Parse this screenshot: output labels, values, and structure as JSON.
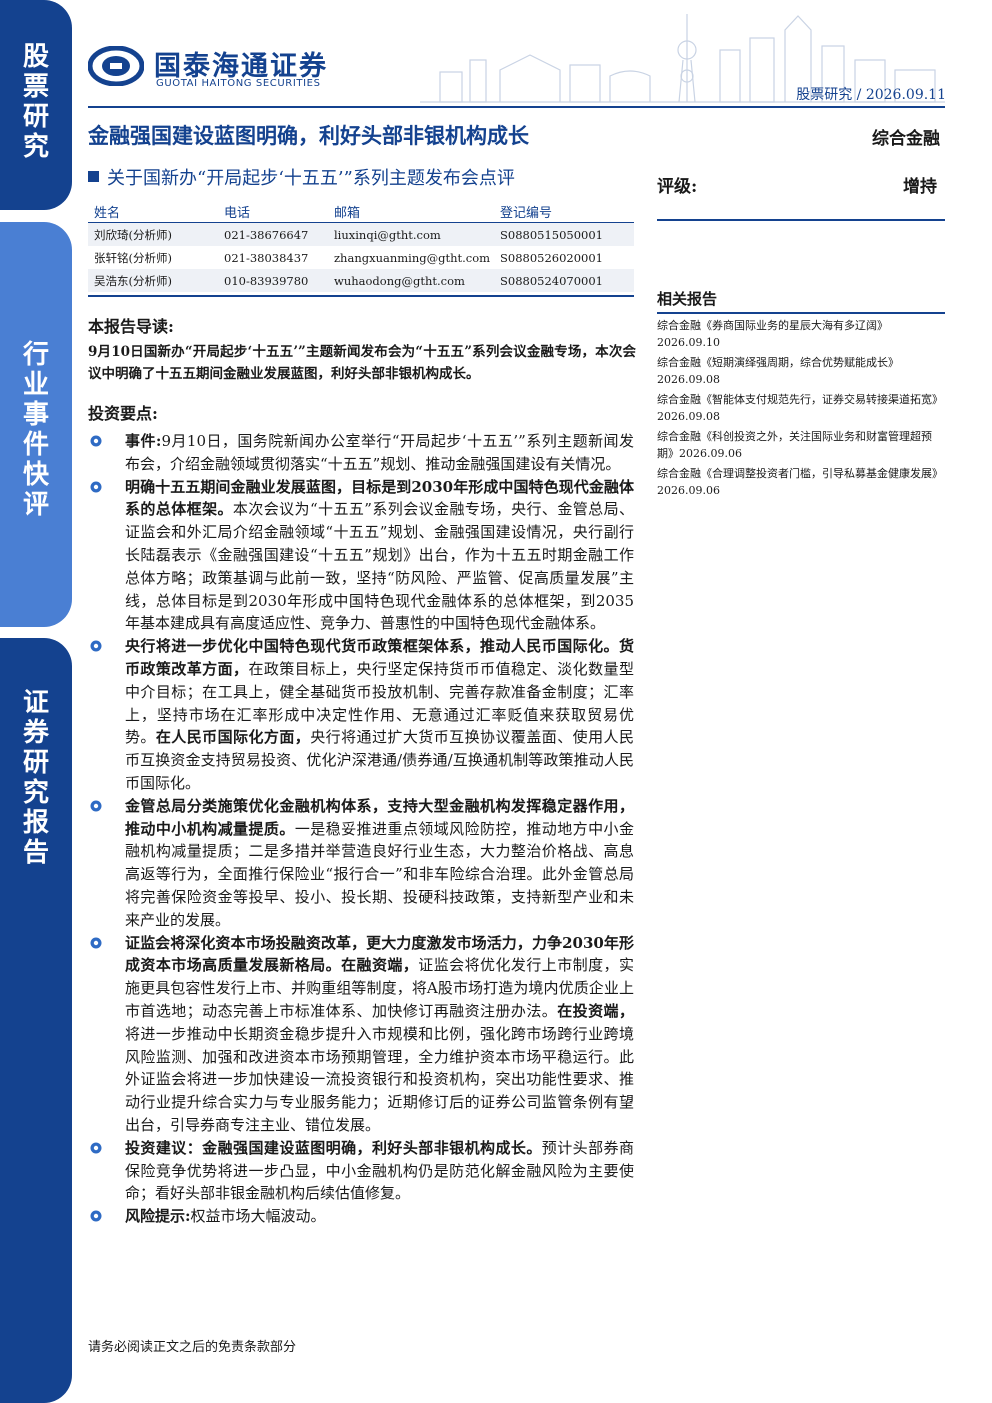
{
  "sidebar": {
    "blocks": [
      {
        "text": "股票研究"
      },
      {
        "text": "行业事件快评"
      },
      {
        "text": "证券研究报告"
      }
    ]
  },
  "logo": {
    "cn": "国泰海通证券",
    "en": "GUOTAI HAITONG SECURITIES"
  },
  "header": {
    "crumb": "股票研究  /  2026.09.11"
  },
  "title": "金融强国建设蓝图明确，利好头部非银机构成长",
  "industry": "综合金融",
  "subtitle": "关于国新办“开局起步‘十五五’”系列主题发布会点评",
  "rating": {
    "label": "评级:",
    "value": "增持"
  },
  "analysts": {
    "headers": [
      "姓名",
      "电话",
      "邮箱",
      "登记编号"
    ],
    "rows": [
      [
        "刘欣琦(分析师)",
        "021-38676647",
        "liuxinqi@gtht.com",
        "S0880515050001"
      ],
      [
        "张轩铭(分析师)",
        "021-38038437",
        "zhangxuanming@gtht.com",
        "S0880526020001"
      ],
      [
        "吴浩东(分析师)",
        "010-83939780",
        "wuhaodong@gtht.com",
        "S0880524070001"
      ]
    ]
  },
  "related": {
    "title": "相关报告",
    "items": [
      "综合金融《券商国际业务的星辰大海有多辽阔》2026.09.10",
      "综合金融《短期演绎强周期，综合优势赋能成长》2026.09.08",
      "综合金融《智能体支付规范先行，证券交易转接渠道拓宽》2026.09.08",
      "综合金融《科创投资之外，关注国际业务和财富管理超预期》2026.09.06",
      "综合金融《合理调整投资者门槛，引导私募基金健康发展》2026.09.06"
    ]
  },
  "guide": {
    "heading": "本报告导读:",
    "text": "9月10日国新办“开局起步‘十五五’”主题新闻发布会为“十五五”系列会议金融专场，本次会议中明确了十五五期间金融业发展蓝图，利好头部非银机构成长。"
  },
  "points_heading": "投资要点:",
  "points": [
    {
      "bold": "事件:",
      "text": "9月10日，国务院新闻办公室举行“开局起步‘十五五’”系列主题新闻发布会，介绍金融领域贯彻落实“十五五”规划、推动金融强国建设有关情况。"
    },
    {
      "bold": "明确十五五期间金融业发展蓝图，目标是到2030年形成中国特色现代金融体系的总体框架。",
      "text": "本次会议为“十五五”系列会议金融专场，央行、金管总局、证监会和外汇局介绍金融领域“十五五”规划、金融强国建设情况，央行副行长陆磊表示《金融强国建设“十五五”规划》出台，作为十五五时期金融工作总体方略；政策基调与此前一致，坚持“防风险、严监管、促高质量发展”主线，总体目标是到2030年形成中国特色现代金融体系的总体框架，到2035年基本建成具有高度适应性、竞争力、普惠性的中国特色现代金融体系。"
    },
    {
      "bold": "央行将进一步优化中国特色现代货币政策框架体系，推动人民币国际化。货币政策改革方面，",
      "text": "在政策目标上，央行坚定保持货币币值稳定、淡化数量型中介目标；在工具上，健全基础货币投放机制、完善存款准备金制度；汇率上，坚持市场在汇率形成中决定性作用、无意通过汇率贬值来获取贸易优势。",
      "bold2": "在人民币国际化方面，",
      "text2": "央行将通过扩大货币互换协议覆盖面、使用人民币互换资金支持贸易投资、优化沪深港通/债券通/互换通机制等政策推动人民币国际化。"
    },
    {
      "bold": "金管总局分类施策优化金融机构体系，支持大型金融机构发挥稳定器作用，推动中小机构减量提质。",
      "text": "一是稳妥推进重点领域风险防控，推动地方中小金融机构减量提质；二是多措并举营造良好行业生态，大力整治价格战、高息高返等行为，全面推行保险业“报行合一”和非车险综合治理。此外金管总局将完善保险资金等投早、投小、投长期、投硬科技政策，支持新型产业和未来产业的发展。"
    },
    {
      "bold": "证监会将深化资本市场投融资改革，更大力度激发市场活力，力争2030年形成资本市场高质量发展新格局。在融资端，",
      "text": "证监会将优化发行上市制度，实施更具包容性发行上市、并购重组等制度，将A股市场打造为境内优质企业上市首选地；动态完善上市标准体系、加快修订再融资注册办法。",
      "bold2": "在投资端，",
      "text2": "将进一步推动中长期资金稳步提升入市规模和比例，强化跨市场跨行业跨境风险监测、加强和改进资本市场预期管理，全力维护资本市场平稳运行。此外证监会将进一步加快建设一流投资银行和投资机构，突出功能性要求、推动行业提升综合实力与专业服务能力；近期修订后的证券公司监管条例有望出台，引导券商专注主业、错位发展。"
    },
    {
      "bold": "投资建议：金融强国建设蓝图明确，利好头部非银机构成长。",
      "text": "预计头部券商保险竞争优势将进一步凸显，中小金融机构仍是防范化解金融风险为主要使命；看好头部非银金融机构后续估值修复。"
    },
    {
      "bold": "风险提示:",
      "text": "权益市场大幅波动。"
    }
  ],
  "footer": "请务必阅读正文之后的免责条款部分",
  "colors": {
    "brand": "#14428f",
    "brand_light": "#4a7fd3",
    "bullet": "#2f6bc4"
  }
}
